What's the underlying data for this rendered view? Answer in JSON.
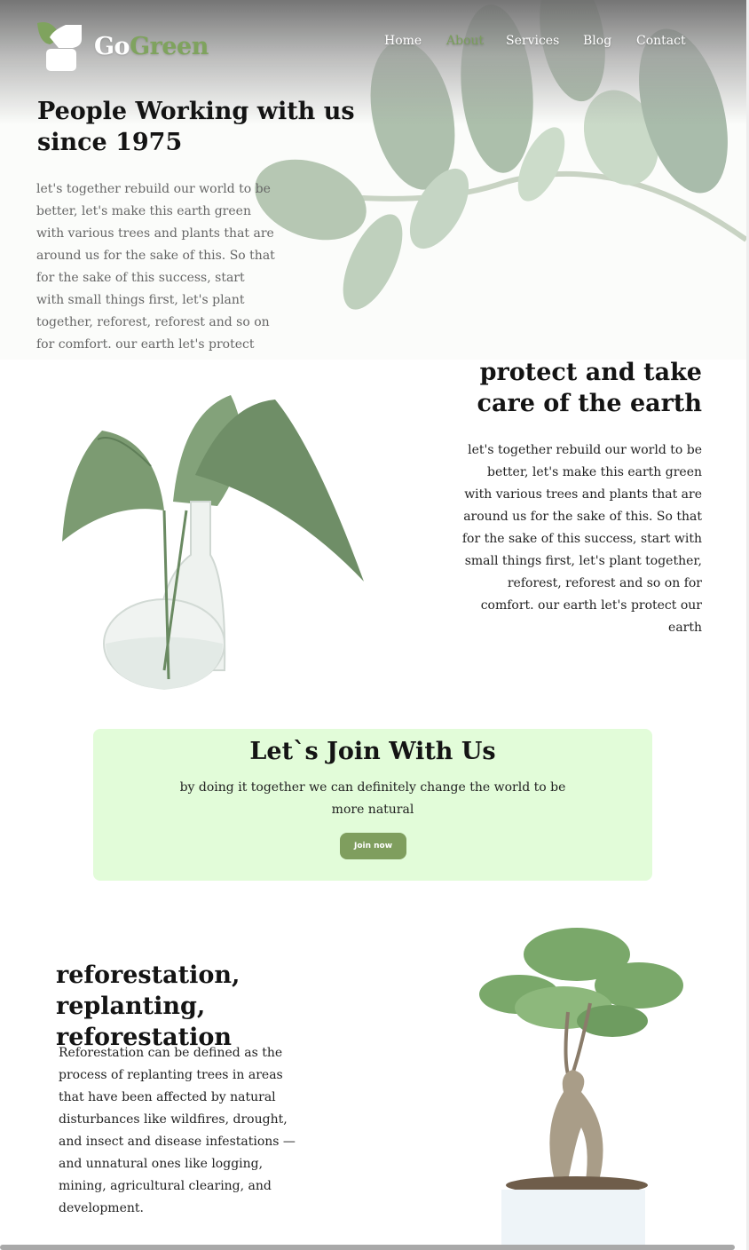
{
  "brand": {
    "part1": "Go",
    "part2": "Green",
    "accent": "#7fa35e"
  },
  "nav": {
    "items": [
      {
        "label": "Home"
      },
      {
        "label": "About",
        "active": true
      },
      {
        "label": "Services"
      },
      {
        "label": "Blog"
      },
      {
        "label": "Contact"
      }
    ]
  },
  "hero": {
    "title": "People Working with us since 1975",
    "description": "let's together rebuild our world to be better, let's make this earth green with various trees and plants that are around us for the sake of this. So that for the sake of this success, start with small things first, let's plant together, reforest, reforest and so on for comfort. our earth let's protect our earth",
    "image": "leafy-branch"
  },
  "about": {
    "title": "protect and take care of the earth",
    "description": "let's together rebuild our world to be better, let's make this earth green with various trees and plants that are around us for the sake of this. So that for the sake of this success, start with small things first, let's plant together, reforest, reforest and so on for comfort. our earth let's protect our earth",
    "image": "plant-in-glass-vase"
  },
  "join": {
    "title": "Let`s Join With Us",
    "description": "by doing it together we can definitely change the world to be more natural",
    "button_label": "Join now",
    "background": "#e2fcd9",
    "button_color": "#7f9e5e"
  },
  "reforestation": {
    "title": "reforestation, replanting, reforestation",
    "description": "Reforestation can be defined as the process of replanting trees in areas that have been affected by natural disturbances like wildfires, drought, and insect and disease infestations — and unnatural ones like logging, mining, agricultural clearing, and development.",
    "image": "bonsai-tree-pot"
  }
}
